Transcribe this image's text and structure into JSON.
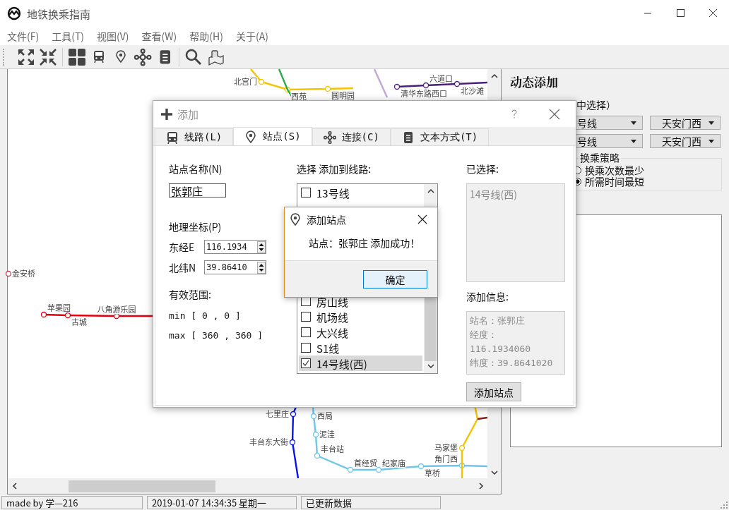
{
  "window": {
    "title": "地铁换乘指南"
  },
  "menu": [
    "文件(F)",
    "工具(T)",
    "视图(V)",
    "查看(W)",
    "帮助(H)",
    "关于(A)"
  ],
  "map": {
    "lines": [
      {
        "color": "#f5c400",
        "stations": [
          "北宫门",
          "西苑",
          "圆明园"
        ]
      },
      {
        "color": "#2fa84f"
      },
      {
        "color": "#c0a8d8"
      },
      {
        "color": "#4b1f7a",
        "stations": [
          "清华东路西口",
          "六道口",
          "北沙滩"
        ]
      },
      {
        "color": "#c23a5a",
        "stations": [
          "金安桥"
        ]
      },
      {
        "color": "#e00010",
        "stations": [
          "苹果园",
          "古城",
          "八角游乐园"
        ]
      },
      {
        "color": "#0a14e8",
        "stations": [
          "七里庄",
          "丰台东大街"
        ]
      },
      {
        "color": "#6ec6ea",
        "stations": [
          "西局",
          "泥洼",
          "丰台站",
          "首经贸",
          "纪家庙",
          "草桥",
          "角门西"
        ]
      },
      {
        "color": "#f5c400",
        "stations": [
          "马家堡"
        ]
      },
      {
        "color": "#8b1a1a"
      }
    ]
  },
  "side_panel": {
    "title": "动态添加",
    "hint": "中选择）",
    "route_rows": [
      {
        "line": "号线",
        "station": "天安门西"
      },
      {
        "line": "号线",
        "station": "天安门西"
      }
    ],
    "strategy": {
      "title": "换乘策略",
      "options": [
        {
          "label": "换乘次数最少",
          "selected": false
        },
        {
          "label": "所需时间最短",
          "selected": true
        }
      ]
    }
  },
  "dialog": {
    "title": "添加",
    "tabs": [
      {
        "label": "线路(L)",
        "selected": false
      },
      {
        "label": "站点(S)",
        "selected": true
      },
      {
        "label": "连接(C)",
        "selected": false
      },
      {
        "label": "文本方式(T)",
        "selected": false
      }
    ],
    "name_label": "站点名称(N)",
    "name_value": "张郭庄",
    "coord_label": "地理坐标(P)",
    "coords": [
      {
        "label": "东经E",
        "value": "116.1934"
      },
      {
        "label": "北纬N",
        "value": "39.86410"
      }
    ],
    "range_label": "有效范围:",
    "range_min": "min [ 0 , 0 ]",
    "range_max": "max [ 360 , 360 ]",
    "lines_label": "选择  添加到线路:",
    "line_items": [
      {
        "label": "13号线",
        "checked": false,
        "selected": false
      },
      {
        "label": "房山线",
        "checked": false,
        "selected": false
      },
      {
        "label": "机场线",
        "checked": false,
        "selected": false
      },
      {
        "label": "大兴线",
        "checked": false,
        "selected": false
      },
      {
        "label": "S1线",
        "checked": false,
        "selected": false
      },
      {
        "label": "14号线(西)",
        "checked": true,
        "selected": true
      }
    ],
    "selected_label": "已选择:",
    "selected_value": "14号线(西)",
    "info_label": "添加信息:",
    "info_lines": [
      "站名：张郭庄",
      "经度：",
      "116.1934060",
      "纬度：39.8641020"
    ],
    "add_button": "添加站点"
  },
  "message_box": {
    "title": "添加站点",
    "message": "站点：张郭庄 添加成功！",
    "ok": "确定"
  },
  "status_bar": [
    "made by 学—216",
    "2019-01-07 14:34:35 星期一",
    "已更新数据"
  ]
}
